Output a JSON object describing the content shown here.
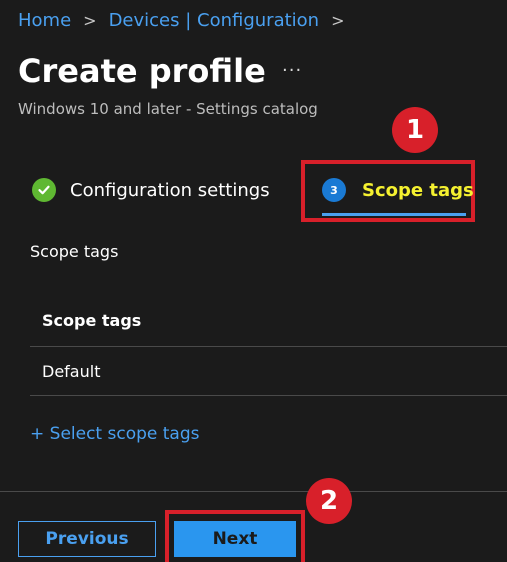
{
  "breadcrumb": {
    "items": [
      "Home",
      "Devices | Configuration"
    ],
    "separator": ">"
  },
  "header": {
    "title": "Create profile",
    "more": "···",
    "subtitle": "Windows 10 and later - Settings catalog"
  },
  "steps": [
    {
      "label": "Configuration settings",
      "status": "complete",
      "icon": "check-icon"
    },
    {
      "number": "3",
      "label": "Scope tags",
      "status": "current"
    }
  ],
  "section": {
    "label": "Scope tags",
    "table": {
      "header": "Scope tags",
      "rows": [
        "Default"
      ]
    },
    "select_link": "+ Select scope tags"
  },
  "footer": {
    "previous": "Previous",
    "next": "Next"
  },
  "annotations": {
    "badge1": "1",
    "badge2": "2"
  },
  "colors": {
    "background": "#1b1b1b",
    "link": "#4aa0f0",
    "accent": "#2a96ef",
    "highlight_text": "#f5f130",
    "annotation": "#d8202a",
    "success": "#5fb832"
  }
}
